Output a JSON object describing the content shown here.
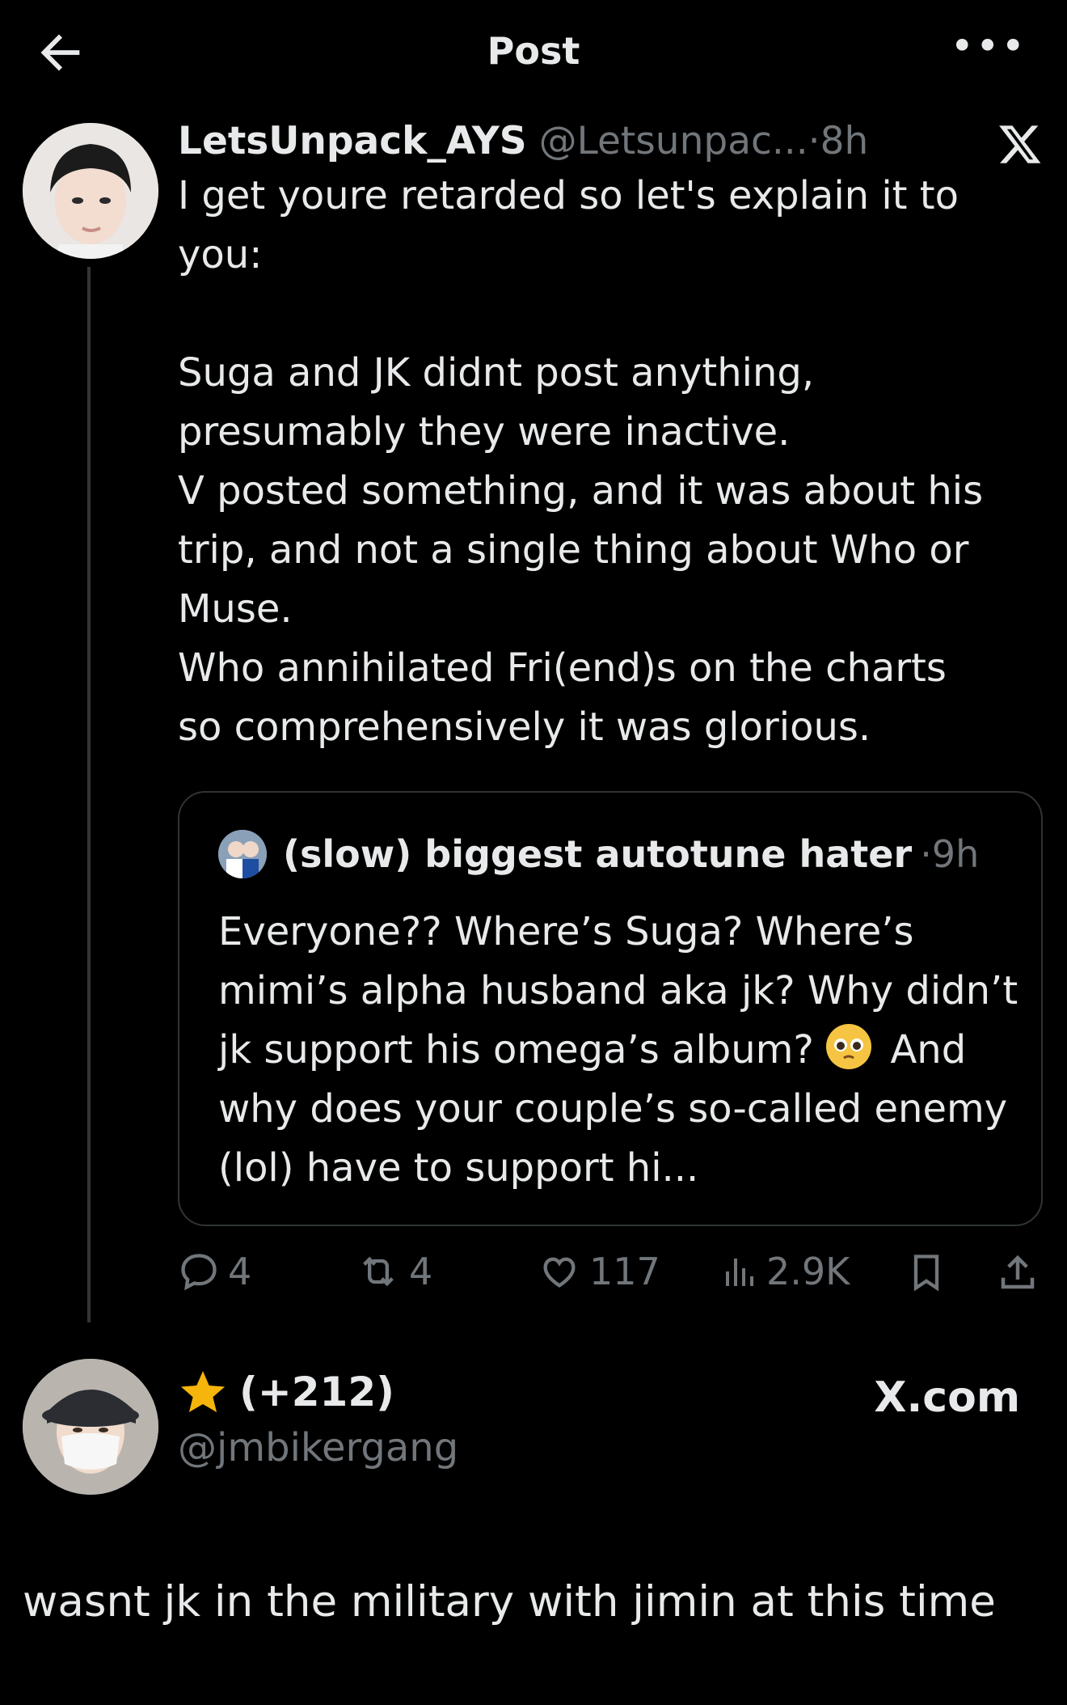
{
  "header": {
    "title": "Post"
  },
  "post": {
    "display_name": "LetsUnpack_AYS",
    "handle": "@Letsunpac...",
    "time": "·8h",
    "text": "I get youre retarded so let's explain it to\nyou:\n\nSuga and JK didnt post anything,\npresumably they were inactive.\nV posted something, and it was about his\ntrip, and not a single thing about Who or\nMuse.\nWho annihilated Fri(end)s on the charts\nso comprehensively it was glorious."
  },
  "quote": {
    "display_name": "(slow) biggest autotune hater",
    "time": "·9h",
    "text_before_emoji": "Everyone?? Where’s Suga? Where’s mimi’s alpha husband aka jk? Why didn’t jk support his omega’s album?",
    "text_after_emoji": "And why does your couple’s so-called enemy (lol) have to support hi..."
  },
  "actions": {
    "replies": "4",
    "reposts": "4",
    "likes": "117",
    "views": "2.9K"
  },
  "reply": {
    "display_name": "(+212)",
    "handle": "@jmbikergang",
    "source": "X.com",
    "text": "wasnt jk in the military with jimin at this time"
  },
  "colors": {
    "background": "#000000",
    "text": "#e7e9ea",
    "muted": "#71767b",
    "border": "#2f3336"
  },
  "icons": [
    "back-arrow-icon",
    "more-icon",
    "x-logo-icon",
    "reply-icon",
    "repost-icon",
    "like-icon",
    "views-icon",
    "bookmark-icon",
    "share-icon",
    "star-icon",
    "pleading-face-emoji"
  ]
}
